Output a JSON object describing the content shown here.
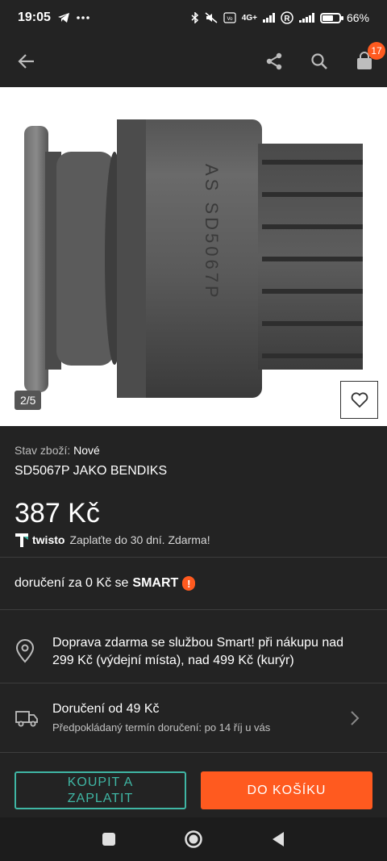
{
  "status_bar": {
    "time": "19:05",
    "battery_percent": "66%",
    "battery_level": 0.66,
    "network": "4G+",
    "icons": [
      "telegram-icon",
      "more-icon",
      "bluetooth-icon",
      "mute-icon",
      "volte-icon",
      "signal-icon",
      "registered-icon",
      "wifi-signal-icon",
      "battery-icon"
    ]
  },
  "app_bar": {
    "cart_count": "17",
    "icons": [
      "back-arrow-icon",
      "share-icon",
      "search-icon",
      "cart-icon"
    ]
  },
  "gallery": {
    "counter": "2/5",
    "marking_text": "AS SD5067P",
    "favorite_icon": "heart-outline-icon"
  },
  "product": {
    "condition_label": "Stav zboží:",
    "condition_value": "Nové",
    "title": "SD5067P JAKO BENDIKS",
    "price": "387 Kč",
    "twisto_brand": "twisto",
    "twisto_text": "Zaplaťte do 30 dní. Zdarma!"
  },
  "smart": {
    "text": "doručení za 0 Kč se",
    "brand": "SMART",
    "badge": "!"
  },
  "free_shipping": {
    "icon": "location-pin-icon",
    "text": "Doprava zdarma se službou Smart! při nákupu nad 299 Kč (výdejní místa), nad 499 Kč (kurýr)"
  },
  "delivery": {
    "icon": "truck-icon",
    "title": "Doručení od 49 Kč",
    "subtitle": "Předpokládaný termín doručení: po 14 říj u vás"
  },
  "actions": {
    "buy_now": "KOUPIT A ZAPLATIT",
    "add_to_cart": "DO KOŠÍKU"
  },
  "colors": {
    "accent_orange": "#ff5a1f",
    "accent_teal": "#3fb6a4",
    "background": "#232323"
  }
}
